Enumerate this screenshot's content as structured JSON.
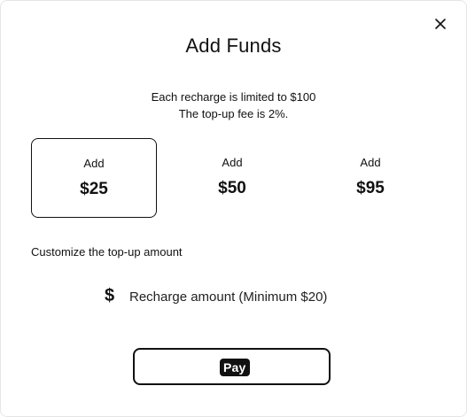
{
  "dialog": {
    "title": "Add Funds",
    "info_line1": "Each recharge is limited to $100",
    "info_line2": "The top-up fee is 2%."
  },
  "options": [
    {
      "label": "Add",
      "amount": "$25",
      "selected": true
    },
    {
      "label": "Add",
      "amount": "$50",
      "selected": false
    },
    {
      "label": "Add",
      "amount": "$95",
      "selected": false
    }
  ],
  "custom": {
    "label": "Customize the top-up amount",
    "currency_symbol": "$",
    "placeholder": "Recharge amount (Minimum $20)",
    "value": ""
  },
  "pay_button": {
    "label": "Pay"
  },
  "icons": {
    "close": "close-icon"
  }
}
